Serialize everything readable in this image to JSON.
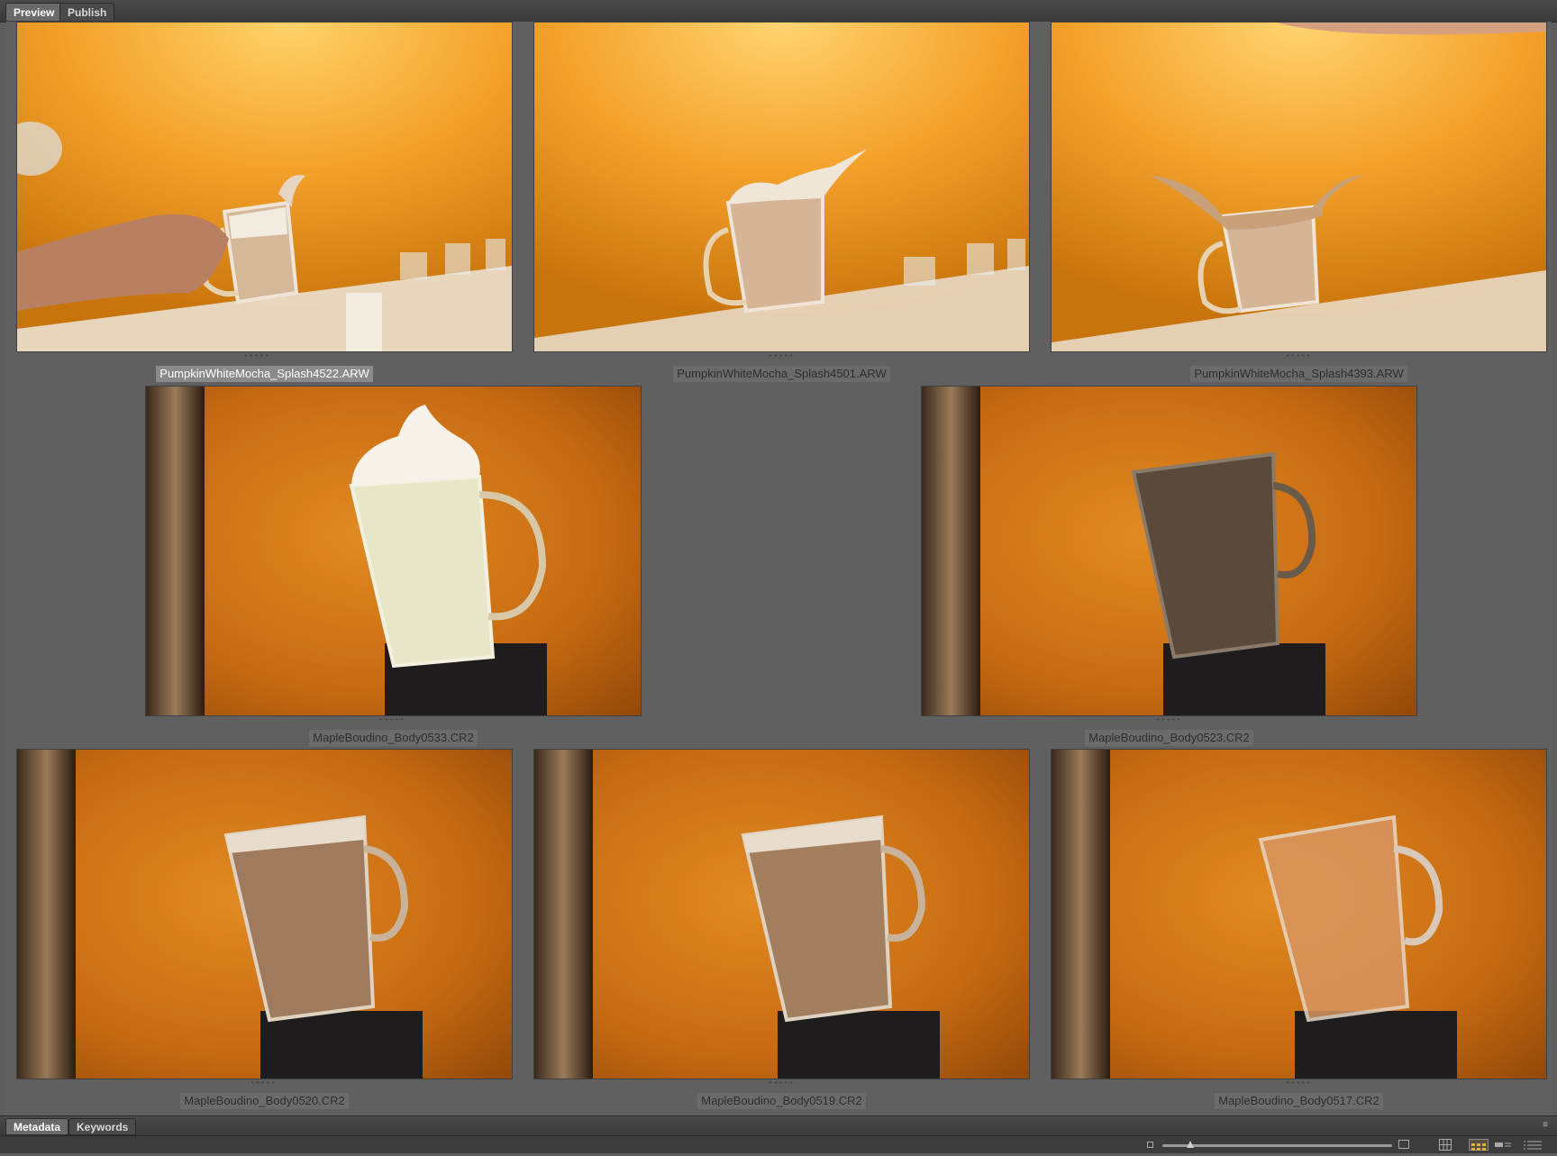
{
  "top_tabs": [
    {
      "label": "Preview",
      "active": true
    },
    {
      "label": "Publish",
      "active": false
    }
  ],
  "bottom_tabs": [
    {
      "label": "Metadata",
      "active": true
    },
    {
      "label": "Keywords",
      "active": false
    }
  ],
  "thumbnails": [
    {
      "filename": "PumpkinWhiteMocha_Splash4522.ARW",
      "selected": true
    },
    {
      "filename": "PumpkinWhiteMocha_Splash4501.ARW",
      "selected": false
    },
    {
      "filename": "PumpkinWhiteMocha_Splash4393.ARW",
      "selected": false
    },
    {
      "filename": "MapleBoudino_Body0533.CR2",
      "selected": false
    },
    {
      "filename": "MapleBoudino_Body0523.CR2",
      "selected": false
    },
    {
      "filename": "MapleBoudino_Body0520.CR2",
      "selected": false
    },
    {
      "filename": "MapleBoudino_Body0519.CR2",
      "selected": false
    },
    {
      "filename": "MapleBoudino_Body0517.CR2",
      "selected": false
    }
  ],
  "colors": {
    "splash_bg": "#f3a12a",
    "body_bg": "#c86a12",
    "selection": "#8a8a8a"
  },
  "status_bar": {
    "thumbnail_size_level": 0.12,
    "icons": [
      "small-thumb-icon",
      "large-thumb-icon",
      "grid-view-icon",
      "filmstrip-view-icon",
      "list-view-icon"
    ]
  }
}
